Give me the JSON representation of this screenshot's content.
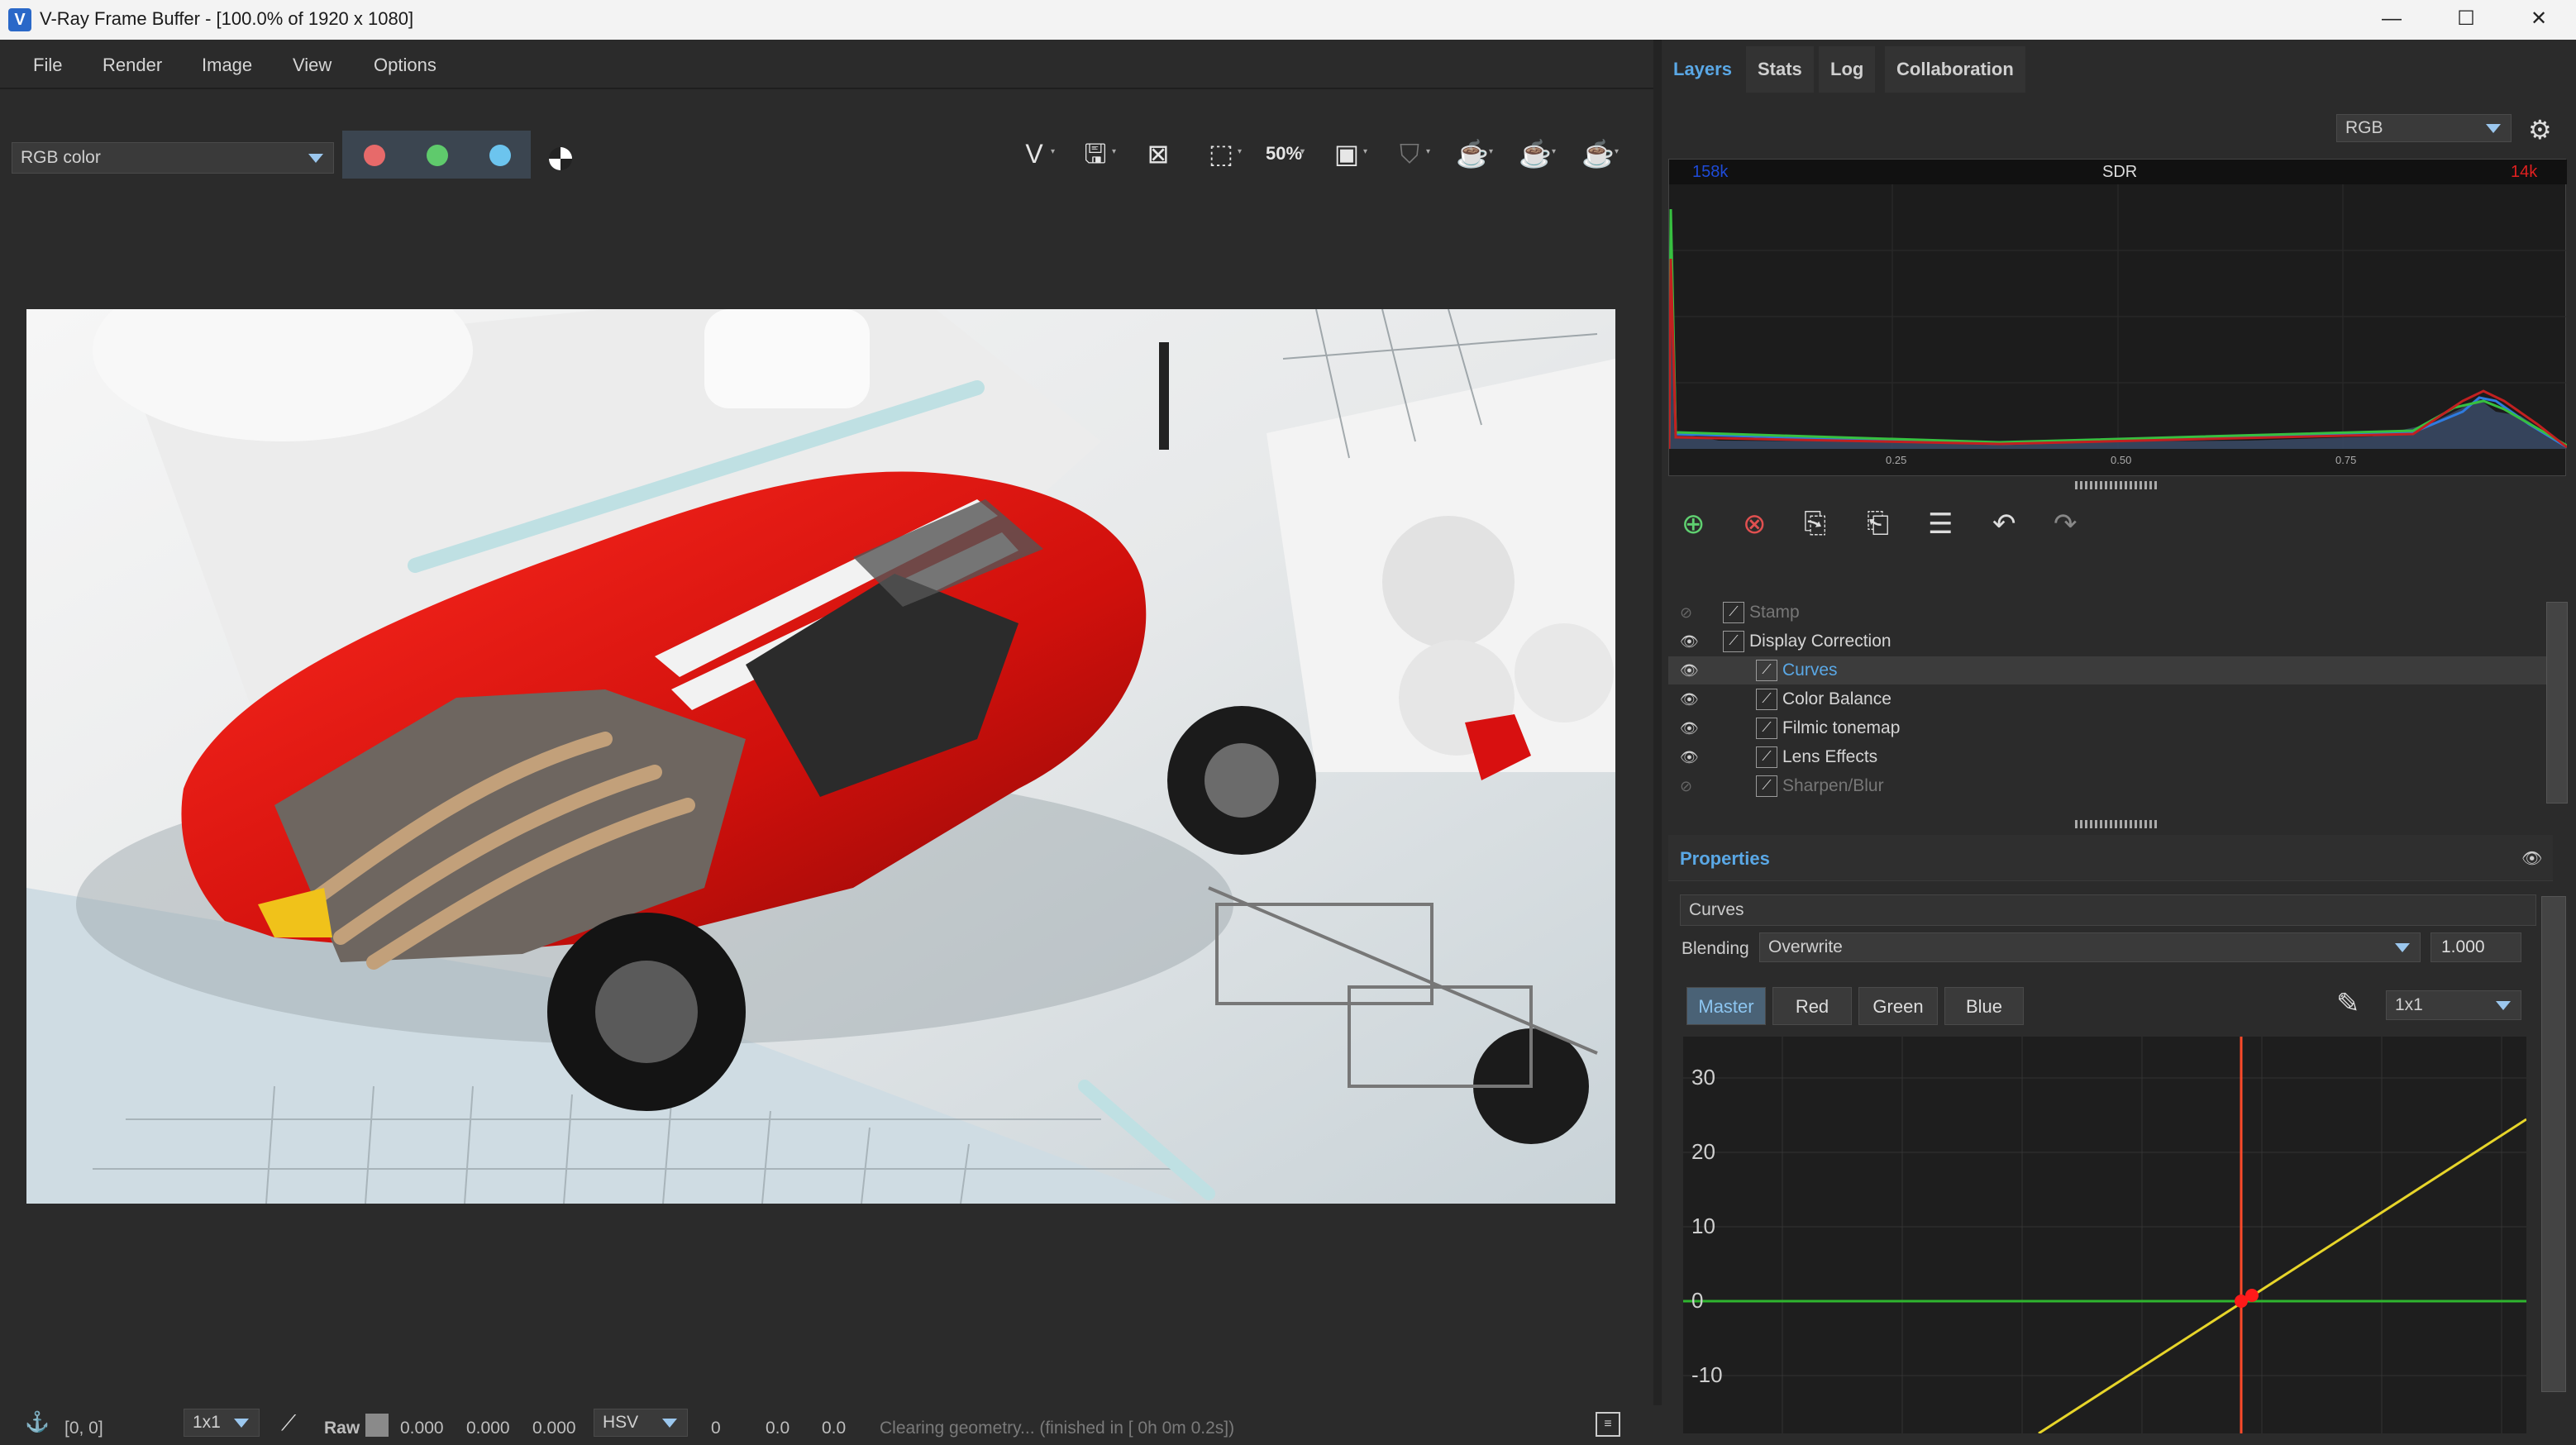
{
  "window": {
    "title": "V-Ray Frame Buffer - [100.0% of 1920 x 1080]",
    "app_icon_glyph": "V",
    "minimize_glyph": "—",
    "maximize_glyph": "☐",
    "close_glyph": "✕"
  },
  "menu": {
    "items": [
      "File",
      "Render",
      "Image",
      "View",
      "Options"
    ]
  },
  "toolbar": {
    "channel_select": "RGB color",
    "channel_colors": {
      "red": "#e76a6a",
      "green": "#5fca6c",
      "blue": "#6cc4ee"
    },
    "zoom_label": "50%",
    "icons": [
      "vray-logo-icon",
      "save-icon",
      "clear-image-icon",
      "region-render-icon",
      "zoom-icon",
      "frame-icon",
      "stop-render-icon",
      "render-teapot-icon",
      "render-interactive-icon",
      "render-last-icon"
    ]
  },
  "statusbar": {
    "coords": "[0, 0]",
    "sampling": "1x1",
    "raw_label": "Raw",
    "raw_values": [
      "0.000",
      "0.000",
      "0.000"
    ],
    "color_space": "HSV",
    "hsv_values": [
      "0",
      "0.0",
      "0.0"
    ],
    "message": "Clearing geometry... (finished in [ 0h  0m  0.2s])"
  },
  "right_panel": {
    "tabs": [
      "Layers",
      "Stats",
      "Log",
      "Collaboration"
    ],
    "active_tab": "Layers",
    "histogram": {
      "channel_select": "RGB",
      "label_left": "158k",
      "label_center": "SDR",
      "label_right": "14k",
      "axis_ticks": [
        "0.25",
        "0.50",
        "0.75"
      ]
    },
    "layers": [
      {
        "name": "Stamp",
        "enabled": false,
        "indent": 0,
        "selected": false
      },
      {
        "name": "Display Correction",
        "enabled": true,
        "indent": 0,
        "selected": false
      },
      {
        "name": "Curves",
        "enabled": true,
        "indent": 1,
        "selected": true
      },
      {
        "name": "Color Balance",
        "enabled": true,
        "indent": 1,
        "selected": false
      },
      {
        "name": "Filmic tonemap",
        "enabled": true,
        "indent": 1,
        "selected": false
      },
      {
        "name": "Lens Effects",
        "enabled": true,
        "indent": 1,
        "selected": false
      },
      {
        "name": "Sharpen/Blur",
        "enabled": false,
        "indent": 1,
        "selected": false
      }
    ],
    "properties": {
      "title": "Properties",
      "layer_name": "Curves",
      "blending_label": "Blending",
      "blending_mode": "Overwrite",
      "opacity": "1.000",
      "channel_buttons": [
        "Master",
        "Red",
        "Green",
        "Blue"
      ],
      "active_channel": "Master",
      "sample_size": "1x1",
      "curve_y_labels": [
        "30",
        "20",
        "10",
        "0",
        "-10"
      ]
    }
  }
}
